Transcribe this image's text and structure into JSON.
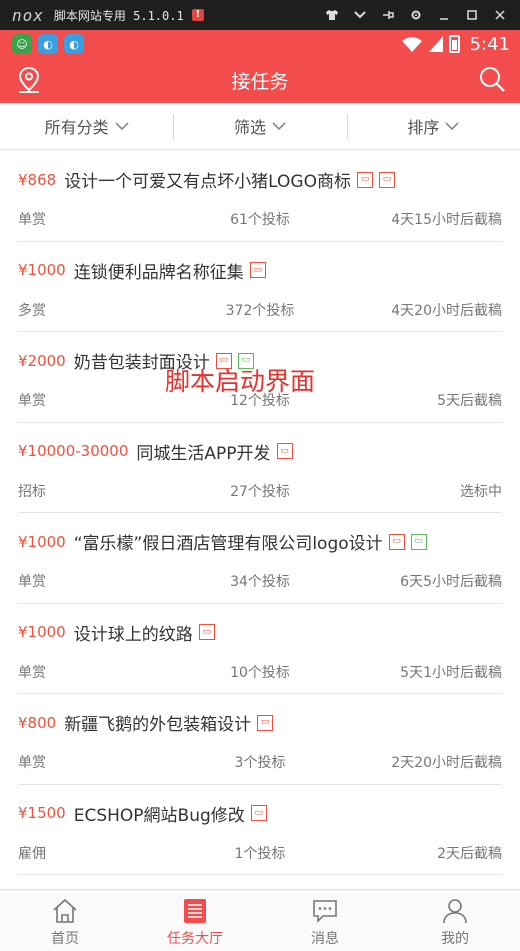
{
  "emulator": {
    "logo": "nox",
    "title": "脚本网站专用 5.1.0.1",
    "warning": "!"
  },
  "status_bar": {
    "time": "5:41"
  },
  "header": {
    "title": "接任务"
  },
  "filters": [
    {
      "label": "所有分类"
    },
    {
      "label": "筛选"
    },
    {
      "label": "排序"
    }
  ],
  "tasks": [
    {
      "price": "¥868",
      "title": "设计一个可爱又有点坏小猪LOGO商标",
      "type": "单赏",
      "bids": "61个投标",
      "deadline": "4天15小时后截稿"
    },
    {
      "price": "¥1000",
      "title": "连锁便利品牌名称征集",
      "type": "多赏",
      "bids": "372个投标",
      "deadline": "4天20小时后截稿"
    },
    {
      "price": "¥2000",
      "title": "奶昔包装封面设计",
      "type": "单赏",
      "bids": "12个投标",
      "deadline": "5天后截稿"
    },
    {
      "price": "¥10000-30000",
      "title": "同城生活APP开发",
      "type": "招标",
      "bids": "27个投标",
      "deadline": "选标中"
    },
    {
      "price": "¥1000",
      "title": "“富乐檬”假日酒店管理有限公司logo设计",
      "type": "单赏",
      "bids": "34个投标",
      "deadline": "6天5小时后截稿"
    },
    {
      "price": "¥1000",
      "title": "设计球上的纹路",
      "type": "单赏",
      "bids": "10个投标",
      "deadline": "5天1小时后截稿"
    },
    {
      "price": "¥800",
      "title": "新疆飞鹅的外包装箱设计",
      "type": "单赏",
      "bids": "3个投标",
      "deadline": "2天20小时后截稿"
    },
    {
      "price": "¥1500",
      "title": "ECSHOP網站Bug修改",
      "type": "雇佣",
      "bids": "1个投标",
      "deadline": "2天后截稿"
    }
  ],
  "watermark": "脚本启动界面",
  "tabs": [
    {
      "label": "首页"
    },
    {
      "label": "任务大厅"
    },
    {
      "label": "消息"
    },
    {
      "label": "我的"
    }
  ],
  "colors": {
    "brand": "#f24c4c",
    "price": "#f0503c",
    "tag_green": "#5cb85c"
  }
}
